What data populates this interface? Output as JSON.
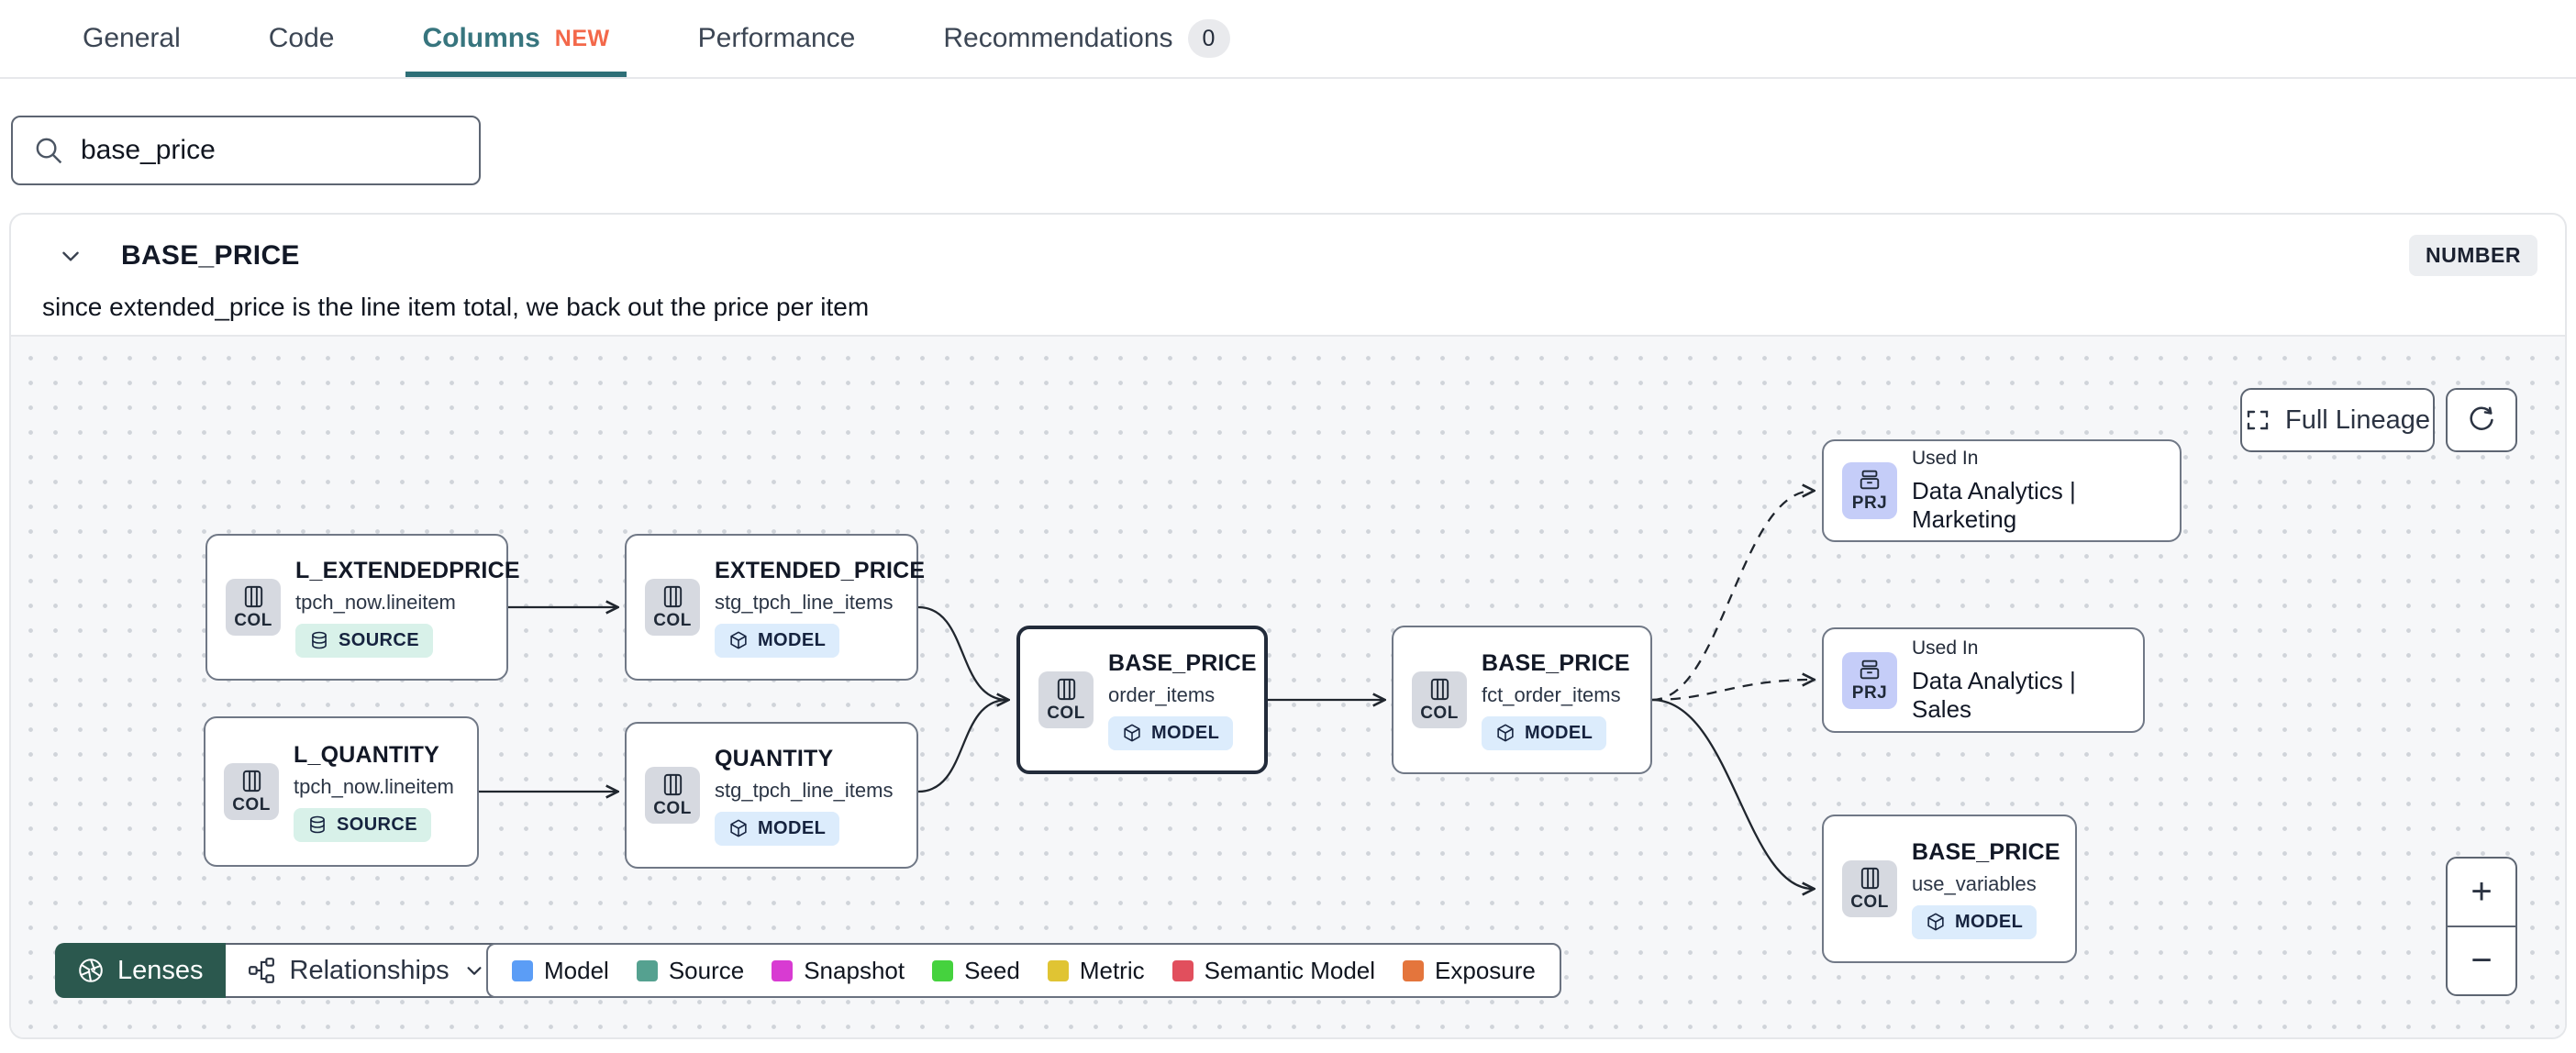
{
  "tabs": [
    {
      "label": "General"
    },
    {
      "label": "Code"
    },
    {
      "label": "Columns",
      "badge": "NEW",
      "active": true
    },
    {
      "label": "Performance"
    },
    {
      "label": "Recommendations",
      "count": "0"
    }
  ],
  "search": {
    "value": "base_price"
  },
  "column_panel": {
    "title": "BASE_PRICE",
    "type_badge": "NUMBER",
    "description": "since extended_price is the line item total, we back out the price per item"
  },
  "lineage": {
    "nodes": [
      {
        "chip": "COL",
        "title": "L_EXTENDEDPRICE",
        "subtitle": "tpch_now.lineitem",
        "badge": "SOURCE"
      },
      {
        "chip": "COL",
        "title": "EXTENDED_PRICE",
        "subtitle": "stg_tpch_line_items",
        "badge": "MODEL"
      },
      {
        "chip": "COL",
        "title": "L_QUANTITY",
        "subtitle": "tpch_now.lineitem",
        "badge": "SOURCE"
      },
      {
        "chip": "COL",
        "title": "QUANTITY",
        "subtitle": "stg_tpch_line_items",
        "badge": "MODEL"
      },
      {
        "chip": "COL",
        "title": "BASE_PRICE",
        "subtitle": "order_items",
        "badge": "MODEL"
      },
      {
        "chip": "COL",
        "title": "BASE_PRICE",
        "subtitle": "fct_order_items",
        "badge": "MODEL"
      },
      {
        "chip": "PRJ",
        "label": "Used In",
        "title": "Data Analytics | Marketing"
      },
      {
        "chip": "PRJ",
        "label": "Used In",
        "title": "Data Analytics | Sales"
      },
      {
        "chip": "COL",
        "title": "BASE_PRICE",
        "subtitle": "use_variables",
        "badge": "MODEL"
      }
    ],
    "controls": {
      "full_lineage": "Full Lineage",
      "zoom_in": "+",
      "zoom_out": "−"
    },
    "toolbar": {
      "lenses": "Lenses",
      "relationships": "Relationships"
    },
    "legend": [
      {
        "label": "Model",
        "color": "#5b9df6"
      },
      {
        "label": "Source",
        "color": "#55a190"
      },
      {
        "label": "Snapshot",
        "color": "#d83bd2"
      },
      {
        "label": "Seed",
        "color": "#45d23e"
      },
      {
        "label": "Metric",
        "color": "#e0c433"
      },
      {
        "label": "Semantic Model",
        "color": "#e14f5d"
      },
      {
        "label": "Exposure",
        "color": "#e4753c"
      }
    ]
  }
}
